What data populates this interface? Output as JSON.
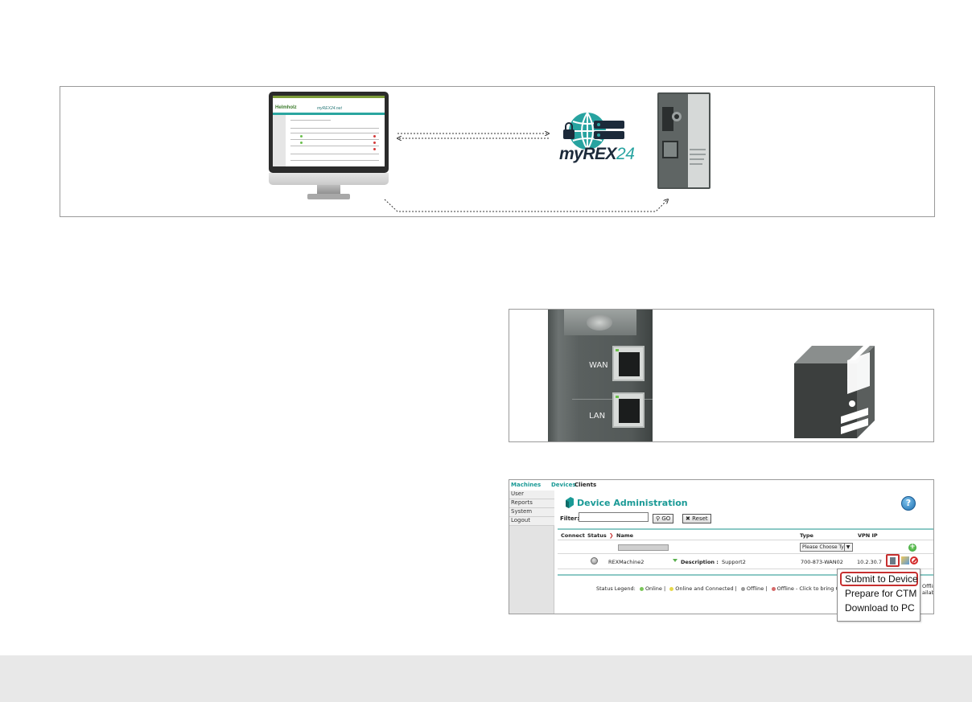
{
  "diagram_top": {
    "brand_word": "myREX",
    "brand_number": "24",
    "mini_screen": {
      "logo": "Helmholz",
      "title": "myREX24.net"
    }
  },
  "diagram_mid": {
    "port_wan": "WAN",
    "port_lan": "LAN"
  },
  "admin": {
    "topnav": {
      "machines": "Machines",
      "devices": "Devices",
      "clients": "Clients"
    },
    "sidebar": [
      "User",
      "Reports",
      "System",
      "Logout"
    ],
    "title": "Device Administration",
    "help": "?",
    "filter_label": "Filter:",
    "go_button": "GO",
    "reset_button": "Reset",
    "columns": {
      "connect": "Connect",
      "status": "Status",
      "name": "Name",
      "type": "Type",
      "vpn_ip": "VPN IP"
    },
    "type_select": "Please Choose Ty",
    "row": {
      "name": "REXMachine2",
      "description_label": "Description :",
      "description": "Support2",
      "type": "700-873-WAN02",
      "vpn_ip": "10.2.30.7"
    },
    "legend": {
      "label": "Status Legend:",
      "online": "Online |",
      "online_connected": "Online and Connected |",
      "offline": "Offline |",
      "offline_click": "Offline - Click to bring C",
      "tail_1": "Offlin",
      "tail_2": "ailabl"
    },
    "colors": {
      "accent": "#1a9a96",
      "highlight": "#c62f2f"
    }
  },
  "context_menu": {
    "items": [
      "Submit to Device",
      "Prepare for CTM",
      "Download to PC"
    ]
  }
}
